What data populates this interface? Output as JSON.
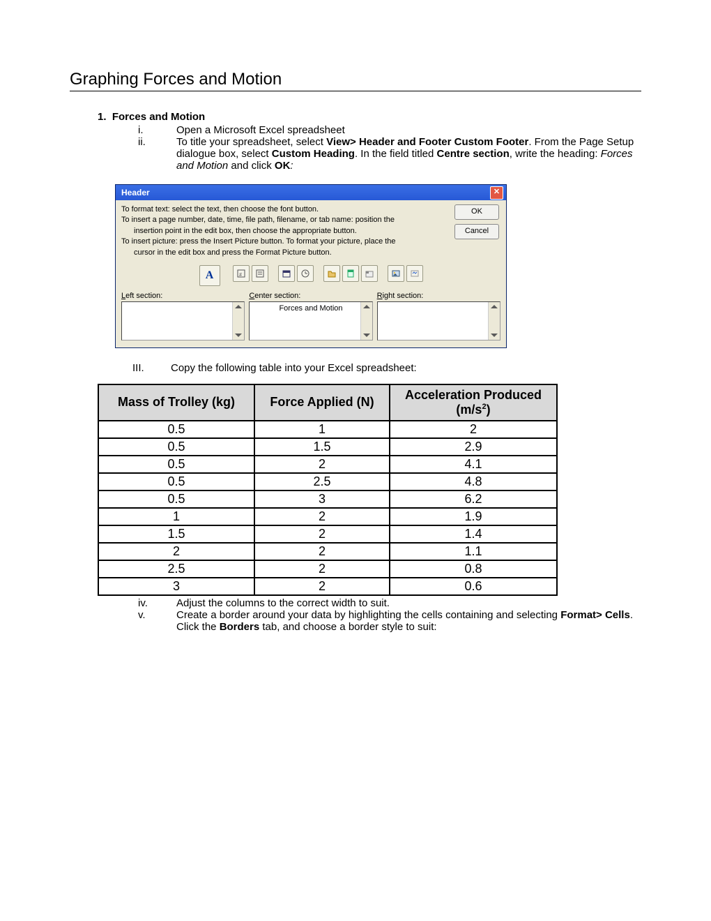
{
  "doc": {
    "title": "Graphing Forces and Motion",
    "section_number": "1.",
    "section_title": "Forces and Motion",
    "items": {
      "i_num": "i.",
      "i_text": "Open a Microsoft Excel spreadsheet",
      "ii_num": "ii.",
      "ii_pre": "To title your spreadsheet, select ",
      "ii_b1": "View> Header and Footer Custom Footer",
      "ii_mid1": ". From the Page Setup dialogue box, select ",
      "ii_b2": "Custom Heading",
      "ii_mid2": ". In the field titled ",
      "ii_b3": "Centre section",
      "ii_mid3": ", write the heading: ",
      "ii_i1": "Forces and Motion",
      "ii_mid4": " and click ",
      "ii_b4": "OK",
      "ii_end": ":",
      "III_num": "III.",
      "III_text": "Copy the following table into your Excel spreadsheet:",
      "iv_num": "iv.",
      "iv_text": "Adjust the columns to the correct width to suit.",
      "v_num": "v.",
      "v_pre": "Create a border around your data by highlighting the cells containing and selecting ",
      "v_b1": "Format> Cells",
      "v_mid1": ". Click the  ",
      "v_b2": "Borders",
      "v_mid2": " tab, and choose a border style to suit:"
    }
  },
  "dialog": {
    "title": "Header",
    "ok": "OK",
    "cancel": "Cancel",
    "line1": "To format text:  select the text, then choose the font button.",
    "line2": "To insert a page number, date, time, file path, filename, or tab name:  position the",
    "line2b": "insertion point in the edit box, then choose the appropriate button.",
    "line3": "To insert picture: press the Insert Picture button.  To format your picture, place the",
    "line3b": "cursor in the edit box and press the Format Picture button.",
    "left_u": "L",
    "left_rest": "eft section:",
    "center_u": "C",
    "center_rest": "enter section:",
    "right_u": "R",
    "right_rest": "ight section:",
    "center_value": "Forces and Motion",
    "font_A": "A"
  },
  "table": {
    "h1": "Mass of Trolley (kg)",
    "h2": "Force Applied (N)",
    "h3a": "Acceleration Produced (m/s",
    "h3sup": "2",
    "h3b": ")",
    "rows": [
      {
        "mass": "0.5",
        "force": "1",
        "acc": "2"
      },
      {
        "mass": "0.5",
        "force": "1.5",
        "acc": "2.9"
      },
      {
        "mass": "0.5",
        "force": "2",
        "acc": "4.1"
      },
      {
        "mass": "0.5",
        "force": "2.5",
        "acc": "4.8"
      },
      {
        "mass": "0.5",
        "force": "3",
        "acc": "6.2"
      },
      {
        "mass": "1",
        "force": "2",
        "acc": "1.9"
      },
      {
        "mass": "1.5",
        "force": "2",
        "acc": "1.4"
      },
      {
        "mass": "2",
        "force": "2",
        "acc": "1.1"
      },
      {
        "mass": "2.5",
        "force": "2",
        "acc": "0.8"
      },
      {
        "mass": "3",
        "force": "2",
        "acc": "0.6"
      }
    ]
  }
}
